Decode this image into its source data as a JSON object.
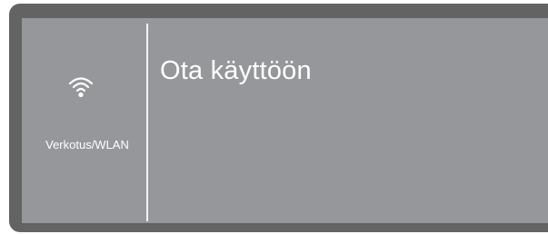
{
  "sidebar": {
    "icon": "wifi-icon",
    "label": "Verkotus/WLAN"
  },
  "main": {
    "title": "Ota käyttöön"
  },
  "colors": {
    "bezel": "#636363",
    "screen": "#96979a",
    "text": "#ffffff"
  }
}
